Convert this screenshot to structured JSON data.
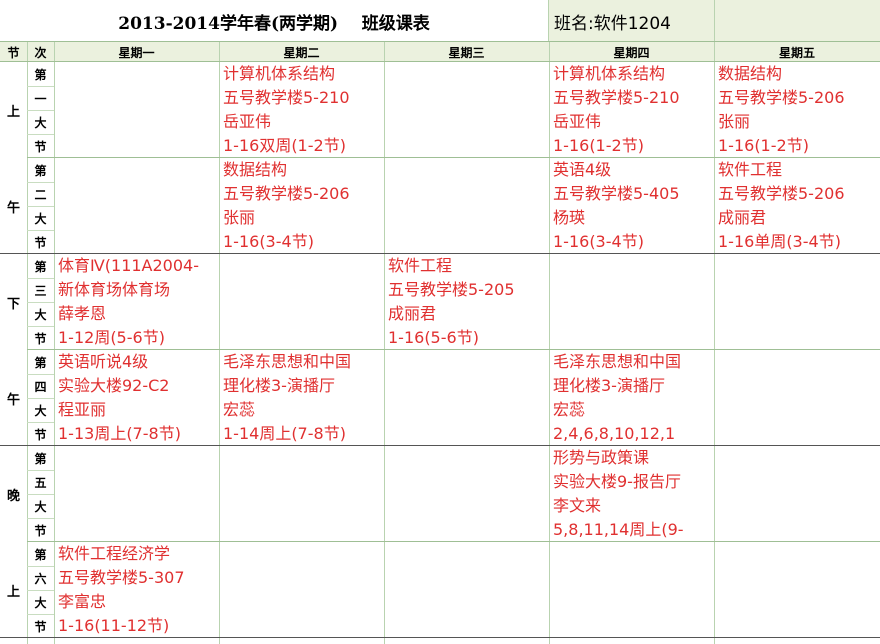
{
  "title": "2013-2014学年春(两学期)    班级课表",
  "class_label": "班名:软件1204",
  "header": {
    "jie": "节",
    "ci": "次",
    "days": [
      "星期一",
      "星期二",
      "星期三",
      "星期四",
      "星期五"
    ]
  },
  "parts": [
    {
      "chars": [
        "上",
        "午"
      ]
    },
    {
      "chars": [
        "下",
        "午"
      ]
    },
    {
      "chars": [
        "晚",
        "上"
      ]
    }
  ],
  "periods": [
    [
      "第",
      "一",
      "大",
      "节"
    ],
    [
      "第",
      "二",
      "大",
      "节"
    ],
    [
      "第",
      "三",
      "大",
      "节"
    ],
    [
      "第",
      "四",
      "大",
      "节"
    ],
    [
      "第",
      "五",
      "大",
      "节"
    ],
    [
      "第",
      "六",
      "大",
      "节"
    ]
  ],
  "schedule": [
    [
      [],
      [
        "计算机体系结构",
        "五号教学楼5-210",
        "岳亚伟",
        "1-16双周(1-2节)"
      ],
      [],
      [
        "计算机体系结构",
        "五号教学楼5-210",
        "岳亚伟",
        "1-16(1-2节)"
      ],
      [
        "数据结构",
        "五号教学楼5-206",
        "张丽",
        "1-16(1-2节)"
      ]
    ],
    [
      [],
      [
        "数据结构",
        "五号教学楼5-206",
        "张丽",
        "1-16(3-4节)"
      ],
      [],
      [
        "英语4级",
        "五号教学楼5-405",
        "杨瑛",
        "1-16(3-4节)"
      ],
      [
        "软件工程",
        "五号教学楼5-206",
        "成丽君",
        "1-16单周(3-4节)"
      ]
    ],
    [
      [
        "体育Ⅳ(111A2004-",
        "新体育场体育场",
        "薛孝恩",
        "1-12周(5-6节)"
      ],
      [],
      [
        "软件工程",
        "五号教学楼5-205",
        "成丽君",
        "1-16(5-6节)"
      ],
      [],
      []
    ],
    [
      [
        "英语听说4级",
        "实验大楼92-C2",
        "程亚丽",
        "1-13周上(7-8节)"
      ],
      [
        "毛泽东思想和中国",
        "理化楼3-演播厅",
        "宏蕊",
        "1-14周上(7-8节)"
      ],
      [],
      [
        "毛泽东思想和中国",
        "理化楼3-演播厅",
        "宏蕊",
        "2,4,6,8,10,12,1"
      ],
      []
    ],
    [
      [],
      [],
      [],
      [
        "形势与政策课",
        "实验大楼9-报告厅",
        "李文来",
        "5,8,11,14周上(9-"
      ],
      []
    ],
    [
      [
        "软件工程经济学",
        "五号教学楼5-307",
        "李富忠",
        "1-16(11-12节)"
      ],
      [],
      [],
      [],
      []
    ]
  ]
}
